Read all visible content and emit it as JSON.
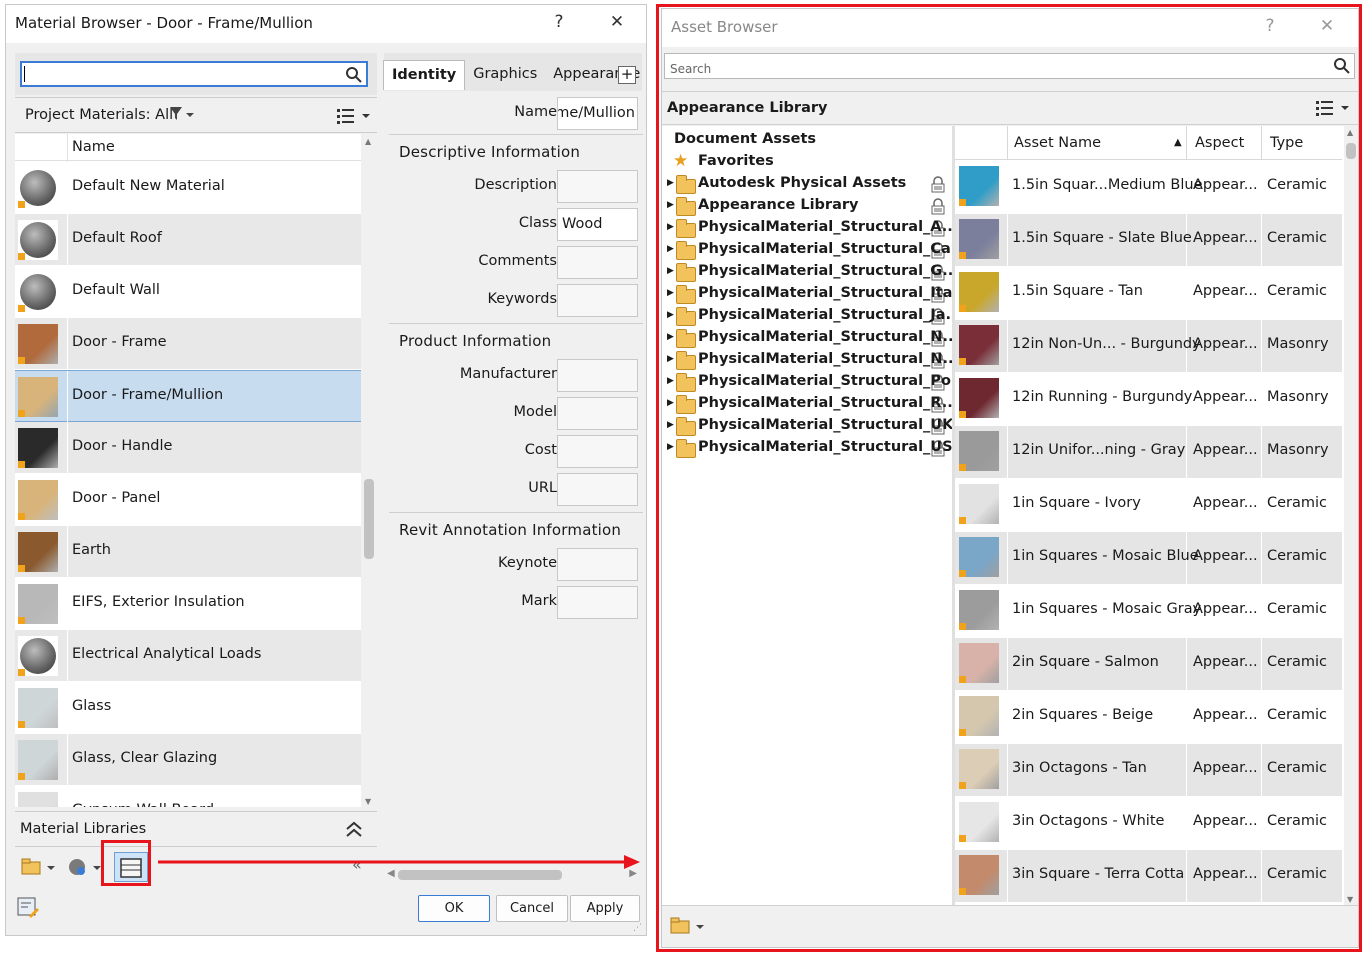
{
  "material_browser": {
    "title": "Material Browser - Door - Frame/Mullion",
    "help": "?",
    "close": "✕",
    "search_value": "",
    "filter_label": "Project Materials: All",
    "column_name": "Name",
    "materials": [
      {
        "name": "Default New Material",
        "color": "#6a6a6a",
        "kind": "sphere"
      },
      {
        "name": "Default Roof",
        "color": "#6a6a6a",
        "kind": "sphere"
      },
      {
        "name": "Default Wall",
        "color": "#6a6a6a",
        "kind": "sphere"
      },
      {
        "name": "Door - Frame",
        "color": "#b06a3c",
        "kind": "box"
      },
      {
        "name": "Door - Frame/Mullion",
        "color": "#d8b47a",
        "kind": "box",
        "selected": true
      },
      {
        "name": "Door - Handle",
        "color": "#2a2a2a",
        "kind": "box"
      },
      {
        "name": "Door - Panel",
        "color": "#d8b47a",
        "kind": "box"
      },
      {
        "name": "Earth",
        "color": "#8a5a2e",
        "kind": "box"
      },
      {
        "name": "EIFS, Exterior Insulation",
        "color": "#b8b8b8",
        "kind": "box"
      },
      {
        "name": "Electrical Analytical Loads",
        "color": "#6a6a6a",
        "kind": "sphere"
      },
      {
        "name": "Glass",
        "color": "#cfd6d8",
        "kind": "box"
      },
      {
        "name": "Glass, Clear Glazing",
        "color": "#cfd6d8",
        "kind": "box"
      },
      {
        "name": "Gypsum Wall Board",
        "color": "#e0e0e0",
        "kind": "box"
      }
    ],
    "libraries_label": "Material Libraries",
    "tabs": [
      "Identity",
      "Graphics",
      "Appearance"
    ],
    "add_tab": "+",
    "name_label": "Name",
    "name_value": "Door - Frame/Mullion",
    "descriptive_section": "Descriptive Information",
    "descriptive_fields": [
      {
        "label": "Description",
        "value": ""
      },
      {
        "label": "Class",
        "value": "Wood"
      },
      {
        "label": "Comments",
        "value": ""
      },
      {
        "label": "Keywords",
        "value": ""
      }
    ],
    "product_section": "Product Information",
    "product_fields": [
      {
        "label": "Manufacturer",
        "value": ""
      },
      {
        "label": "Model",
        "value": ""
      },
      {
        "label": "Cost",
        "value": ""
      },
      {
        "label": "URL",
        "value": ""
      }
    ],
    "annotation_section": "Revit Annotation Information",
    "annotation_fields": [
      {
        "label": "Keynote",
        "value": ""
      },
      {
        "label": "Mark",
        "value": ""
      }
    ],
    "ok": "OK",
    "cancel": "Cancel",
    "apply": "Apply"
  },
  "asset_browser": {
    "title": "Asset Browser",
    "help": "?",
    "close": "✕",
    "search_placeholder": "Search",
    "library_header": "Appearance Library",
    "tree": [
      {
        "label": "Document Assets",
        "type": "root"
      },
      {
        "label": "Favorites",
        "type": "star"
      },
      {
        "label": "Autodesk Physical Assets",
        "type": "folder"
      },
      {
        "label": "Appearance Library",
        "type": "folder"
      },
      {
        "label": "PhysicalMaterial_Structural_A...",
        "type": "folder"
      },
      {
        "label": "PhysicalMaterial_Structural_Ca...",
        "type": "folder"
      },
      {
        "label": "PhysicalMaterial_Structural_G...",
        "type": "folder"
      },
      {
        "label": "PhysicalMaterial_Structural_Italy",
        "type": "folder"
      },
      {
        "label": "PhysicalMaterial_Structural_Ja...",
        "type": "folder"
      },
      {
        "label": "PhysicalMaterial_Structural_N...",
        "type": "folder"
      },
      {
        "label": "PhysicalMaterial_Structural_N...",
        "type": "folder"
      },
      {
        "label": "PhysicalMaterial_Structural_Po...",
        "type": "folder"
      },
      {
        "label": "PhysicalMaterial_Structural_R...",
        "type": "folder"
      },
      {
        "label": "PhysicalMaterial_Structural_UK",
        "type": "folder"
      },
      {
        "label": "PhysicalMaterial_Structural_US",
        "type": "folder"
      }
    ],
    "columns": [
      "Asset Name",
      "Aspect",
      "Type"
    ],
    "assets": [
      {
        "name": "1.5in Squar...Medium Blue",
        "aspect": "Appear...",
        "type": "Ceramic",
        "color": "#2f9dc7"
      },
      {
        "name": "1.5in Square - Slate Blue",
        "aspect": "Appear...",
        "type": "Ceramic",
        "color": "#7c7f9c"
      },
      {
        "name": "1.5in Square - Tan",
        "aspect": "Appear...",
        "type": "Ceramic",
        "color": "#c9a72b"
      },
      {
        "name": "12in Non-Un... - Burgundy",
        "aspect": "Appear...",
        "type": "Masonry",
        "color": "#7a2e38"
      },
      {
        "name": "12in Running - Burgundy",
        "aspect": "Appear...",
        "type": "Masonry",
        "color": "#6e2830"
      },
      {
        "name": "12in Unifor...ning - Gray",
        "aspect": "Appear...",
        "type": "Masonry",
        "color": "#9a9a9a"
      },
      {
        "name": "1in Square - Ivory",
        "aspect": "Appear...",
        "type": "Ceramic",
        "color": "#e2e2e2"
      },
      {
        "name": "1in Squares - Mosaic Blue",
        "aspect": "Appear...",
        "type": "Ceramic",
        "color": "#7aa6c8"
      },
      {
        "name": "1in Squares - Mosaic Gray",
        "aspect": "Appear...",
        "type": "Ceramic",
        "color": "#9c9c9c"
      },
      {
        "name": "2in Square - Salmon",
        "aspect": "Appear...",
        "type": "Ceramic",
        "color": "#d8b2a8"
      },
      {
        "name": "2in Squares - Beige",
        "aspect": "Appear...",
        "type": "Ceramic",
        "color": "#d4c7ae"
      },
      {
        "name": "3in Octagons - Tan",
        "aspect": "Appear...",
        "type": "Ceramic",
        "color": "#dccdb6"
      },
      {
        "name": "3in Octagons - White",
        "aspect": "Appear...",
        "type": "Ceramic",
        "color": "#e6e6e6"
      },
      {
        "name": "3in Square - Terra Cotta",
        "aspect": "Appear...",
        "type": "Ceramic",
        "color": "#c38a6c"
      }
    ]
  },
  "annotation_color": "#e8141c"
}
